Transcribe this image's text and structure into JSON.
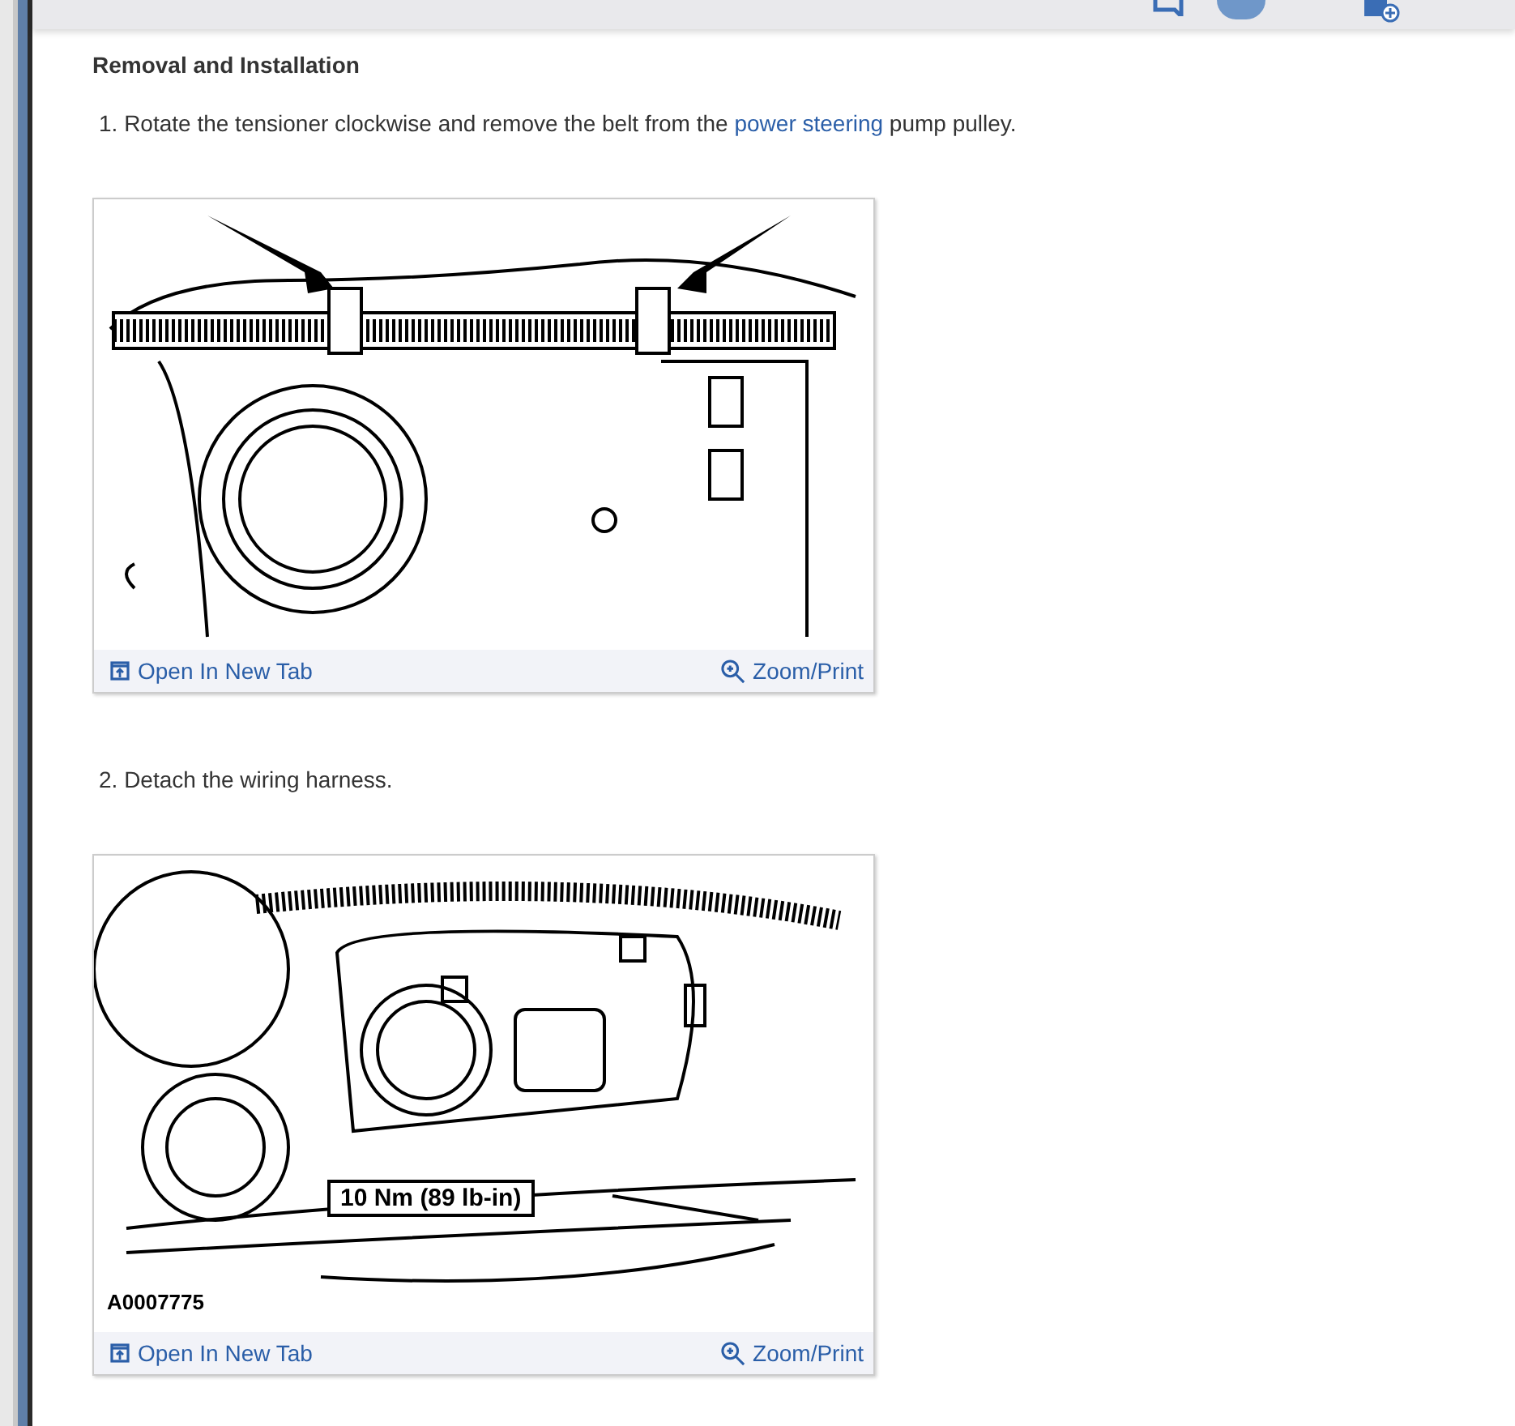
{
  "section_title": "Removal and Installation",
  "steps": [
    {
      "number": "1.",
      "link": "power steering",
      "before": "Rotate the tensioner clockwise and remove the belt from the ",
      "after": " pump pulley.",
      "figure": {
        "kind": "belt",
        "open_label": "Open In New Tab",
        "zoom_label": "Zoom/Print"
      }
    },
    {
      "number": "2.",
      "before": "Detach the wiring harness.",
      "figure": {
        "kind": "harness",
        "callout": "10 Nm (89 lb-in)",
        "code": "A0007775",
        "open_label": "Open In New Tab",
        "zoom_label": "Zoom/Print"
      }
    }
  ]
}
